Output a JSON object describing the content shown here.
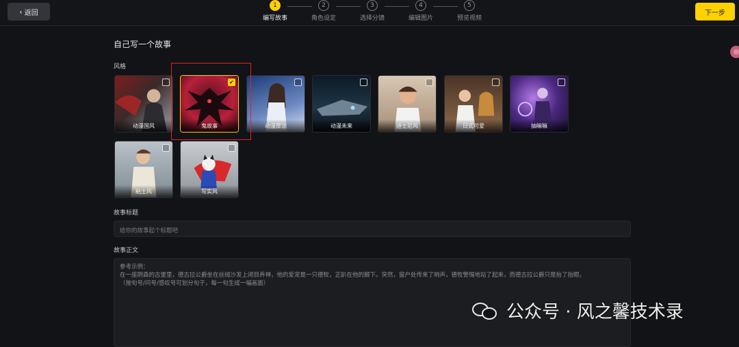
{
  "header": {
    "back_label": "返回",
    "next_label": "下一步",
    "steps": [
      {
        "num": "1",
        "label": "编写故事",
        "active": true
      },
      {
        "num": "2",
        "label": "角色设定",
        "active": false
      },
      {
        "num": "3",
        "label": "选择分镜",
        "active": false
      },
      {
        "num": "4",
        "label": "编辑图片",
        "active": false
      },
      {
        "num": "5",
        "label": "预览视频",
        "active": false
      }
    ]
  },
  "main": {
    "heading": "自己写一个故事",
    "style_label": "风格",
    "styles": [
      {
        "name": "动漫国风",
        "selected": false
      },
      {
        "name": "鬼故事",
        "selected": true
      },
      {
        "name": "动漫厚涂",
        "selected": false
      },
      {
        "name": "动漫未来",
        "selected": false
      },
      {
        "name": "迪士尼风",
        "selected": false
      },
      {
        "name": "日式可爱",
        "selected": false
      },
      {
        "name": "抽嘛嘛",
        "selected": false
      },
      {
        "name": "粘土风",
        "selected": false
      },
      {
        "name": "写实风",
        "selected": false
      }
    ],
    "title_label": "故事标题",
    "title_placeholder": "给你的故事起个标题吧",
    "content_label": "故事正文",
    "content_example": [
      "参考示例：",
      "在一座阴森的古堡里，德古拉公爵坐在丝绒沙发上闭目养神，他的爱宠是一只德牧，正趴在他的脚下。突然，窗户处传来了响声，德牧警惕地站了起来，而德古拉公爵只是抬了抬眼。",
      "（按句号/问号/感叹号可划分句子，每一句生成一幅画面）"
    ]
  },
  "watermark": "公众号 · 风之馨技术录",
  "colors": {
    "accent": "#ffd100",
    "highlight": "#e52121",
    "background": "#121316"
  }
}
